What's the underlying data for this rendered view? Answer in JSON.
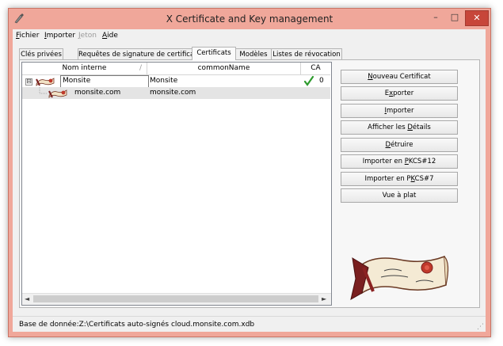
{
  "window": {
    "title": "X Certificate and Key management"
  },
  "window_controls": {
    "minimize": "–",
    "maximize": "□",
    "close": "✕"
  },
  "menu": [
    {
      "label": "Fichier",
      "accel": "F",
      "rest": "ichier",
      "enabled": true
    },
    {
      "label": "Importer",
      "accel": "I",
      "rest": "mporter",
      "enabled": true
    },
    {
      "label": "Jeton",
      "accel": "J",
      "rest": "eton",
      "enabled": false
    },
    {
      "label": "Aide",
      "accel": "A",
      "rest": "ide",
      "enabled": true
    }
  ],
  "tabs": [
    {
      "label": "Clés privées"
    },
    {
      "label": "Requêtes de signature de certificat"
    },
    {
      "label": "Certificats",
      "active": true
    },
    {
      "label": "Modèles"
    },
    {
      "label": "Listes de révocation"
    }
  ],
  "table": {
    "columns": [
      "Nom interne",
      "commonName",
      "CA"
    ],
    "sort_indicator": "/",
    "rows": [
      {
        "name": "Monsite",
        "commonName": "Monsite",
        "ca_checked": true,
        "count": "0",
        "expander": "⊟",
        "level": 0
      },
      {
        "name": "monsite.com",
        "commonName": "monsite.com",
        "level": 1,
        "selected": true
      }
    ]
  },
  "scrollbar": {
    "left_arrow": "◄",
    "right_arrow": "►"
  },
  "buttons": [
    {
      "id": "nouveau",
      "accel": "N",
      "rest": "ouveau Certificat"
    },
    {
      "id": "exporter",
      "pre": "E",
      "accel": "x",
      "rest": "porter"
    },
    {
      "id": "importer",
      "accel": "I",
      "rest": "mporter"
    },
    {
      "id": "details",
      "pre": "Afficher les ",
      "accel": "D",
      "rest": "étails"
    },
    {
      "id": "detruire",
      "accel": "D",
      "rest": "étruire"
    },
    {
      "id": "pkcs12",
      "pre": "Importer en ",
      "accel": "P",
      "rest": "KCS#12"
    },
    {
      "id": "pkcs7",
      "pre": "Importer en P",
      "accel": "K",
      "rest": "CS#7"
    },
    {
      "id": "plat",
      "pre": "Vue à plat",
      "accel": "",
      "rest": ""
    }
  ],
  "status": {
    "text": "Base de donnée:Z:\\Certificats auto-signés cloud.monsite.com.xdb"
  },
  "colors": {
    "title_bar": "#f0a79a",
    "close_button": "#c7463a",
    "check": "#2e9b2e"
  }
}
